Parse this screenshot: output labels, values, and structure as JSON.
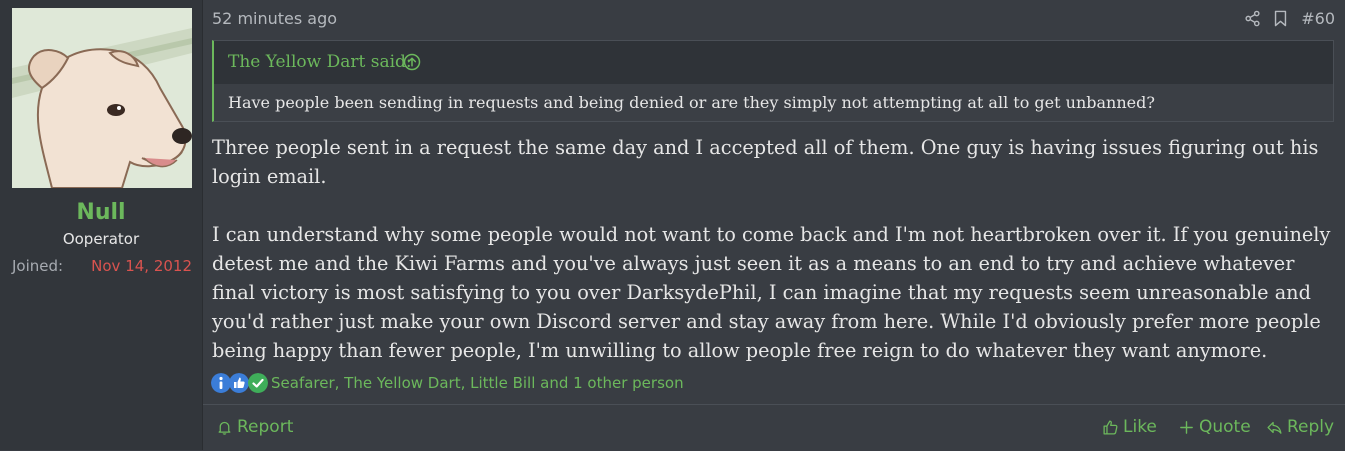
{
  "user": {
    "name": "Null",
    "title": "Ooperator",
    "joined_label": "Joined:",
    "joined_date": "Nov 14, 2012",
    "avatar_icon": "dog-avatar"
  },
  "post": {
    "time": "52 minutes ago",
    "number": "#60",
    "icons": [
      "share-icon",
      "bookmark-icon"
    ],
    "quote": {
      "author": "The Yellow Dart said:",
      "text": "Have people been sending in requests and being denied or are they simply not attempting at all to get unbanned?"
    },
    "paragraphs": [
      "Three people sent in a request the same day and I accepted all of them. One guy is having issues figuring out his login email.",
      "I can understand why some people would not want to come back and I'm not heartbroken over it. If you genuinely detest me and the Kiwi Farms and you've always just seen it as a means to an end to try and achieve whatever final victory is most satisfying to you over DarksydePhil, I can imagine that my requests seem unreasonable and you'd rather just make your own Discord server and stay away from here. While I'd obviously prefer more people being happy than fewer people, I'm unwilling to allow people free reign to do whatever they want anymore."
    ],
    "reactions": {
      "icons": [
        "info-icon",
        "thumbs-up-icon",
        "check-icon"
      ],
      "list": "Seafarer, The Yellow Dart, Little Bill and 1 other person"
    }
  },
  "footer": {
    "report": "Report",
    "like": "Like",
    "quote": "Quote",
    "reply": "Reply"
  },
  "colors": {
    "accent_green": "#6cb85c",
    "date_red": "#d9534f",
    "background": "#393d43",
    "sidebar": "#32363b"
  }
}
